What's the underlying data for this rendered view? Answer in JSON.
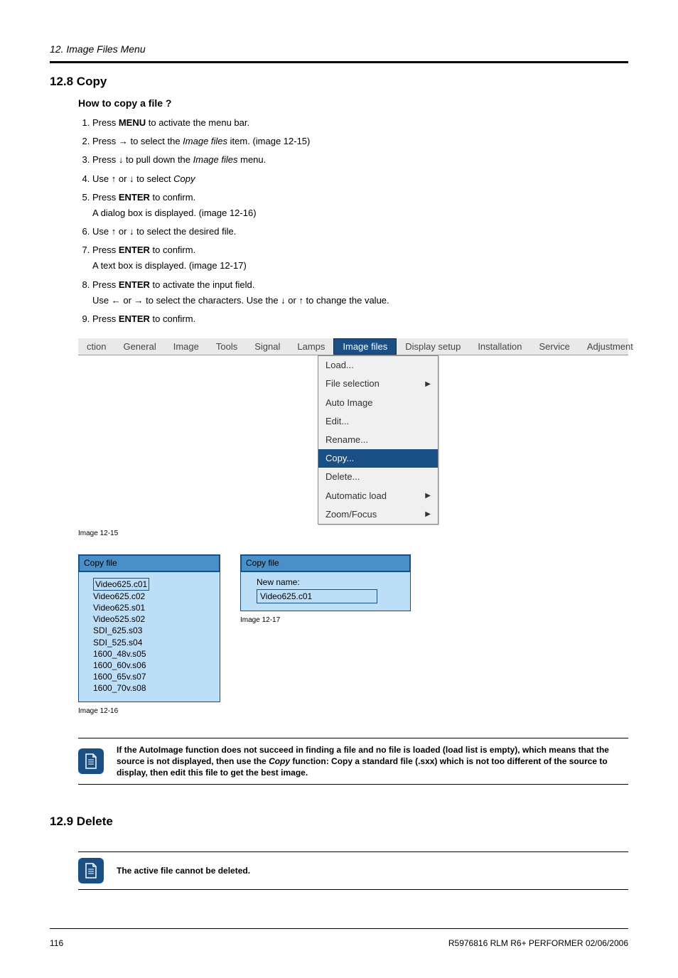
{
  "chapter": "12. Image Files Menu",
  "s1": {
    "num_title": "12.8 Copy",
    "subhead": "How to copy a file ?",
    "steps": {
      "1": {
        "pre": "Press ",
        "bold": "MENU",
        "post": " to activate the menu bar."
      },
      "2": {
        "pre": "Press → to select the ",
        "italic": "Image files",
        "post": " item. (image 12-15)"
      },
      "3": {
        "pre": "Press ↓ to pull down the ",
        "italic": "Image files",
        "post": " menu."
      },
      "4": {
        "pre": "Use ↑ or ↓ to select ",
        "italic": "Copy",
        "post": ""
      },
      "5": {
        "pre": "Press ",
        "bold": "ENTER",
        "post": " to confirm.",
        "sub": "A dialog box is displayed. (image 12-16)"
      },
      "6": "Use ↑ or ↓ to select the desired file.",
      "7": {
        "pre": "Press ",
        "bold": "ENTER",
        "post": " to confirm.",
        "sub": "A text box is displayed. (image 12-17)"
      },
      "8": {
        "pre": "Press ",
        "bold": "ENTER",
        "post": " to activate the input field.",
        "sub": "Use ← or → to select the characters. Use the ↓ or ↑ to change the value."
      },
      "9": {
        "pre": "Press ",
        "bold": "ENTER",
        "post": " to confirm."
      }
    }
  },
  "menubar": {
    "items": [
      {
        "label": "ction"
      },
      {
        "label": "General"
      },
      {
        "label": "Image"
      },
      {
        "label": "Tools"
      },
      {
        "label": "Signal"
      },
      {
        "label": "Lamps"
      },
      {
        "label": "Image files",
        "active": true
      },
      {
        "label": "Display setup"
      },
      {
        "label": "Installation"
      },
      {
        "label": "Service"
      },
      {
        "label": "Adjustment"
      }
    ],
    "submenu": [
      {
        "label": "Load..."
      },
      {
        "label": "File selection",
        "arrow": true
      },
      {
        "label": "Auto Image"
      },
      {
        "label": "Edit..."
      },
      {
        "label": "Rename..."
      },
      {
        "label": "Copy...",
        "active": true
      },
      {
        "label": "Delete..."
      },
      {
        "label": "Automatic load",
        "arrow": true
      },
      {
        "label": "Zoom/Focus",
        "arrow": true
      }
    ],
    "caption": "Image 12-15"
  },
  "dlg16": {
    "title": "Copy file",
    "items": [
      "Video625.c01",
      "Video625.c02",
      "Video625.s01",
      "Video525.s02",
      "SDI_625.s03",
      "SDI_525.s04",
      "1600_48v.s05",
      "1600_60v.s06",
      "1600_65v.s07",
      "1600_70v.s08"
    ],
    "caption": "Image 12-16"
  },
  "dlg17": {
    "title": "Copy file",
    "label": "New name:",
    "value": "Video625.c01",
    "caption": "Image 12-17"
  },
  "note1": {
    "pre": "If the AutoImage function does not succeed in finding a file and no file is loaded (load list is empty), which means that the source is not displayed, then use the ",
    "italic": "Copy",
    "post": " function: Copy a standard file (.sxx) which is not too different of the source to display, then edit this file to get the best image."
  },
  "s2": {
    "num_title": "12.9 Delete"
  },
  "note2": "The active file cannot be deleted.",
  "footer": {
    "page": "116",
    "right": "R5976816 RLM R6+ PERFORMER 02/06/2006"
  }
}
